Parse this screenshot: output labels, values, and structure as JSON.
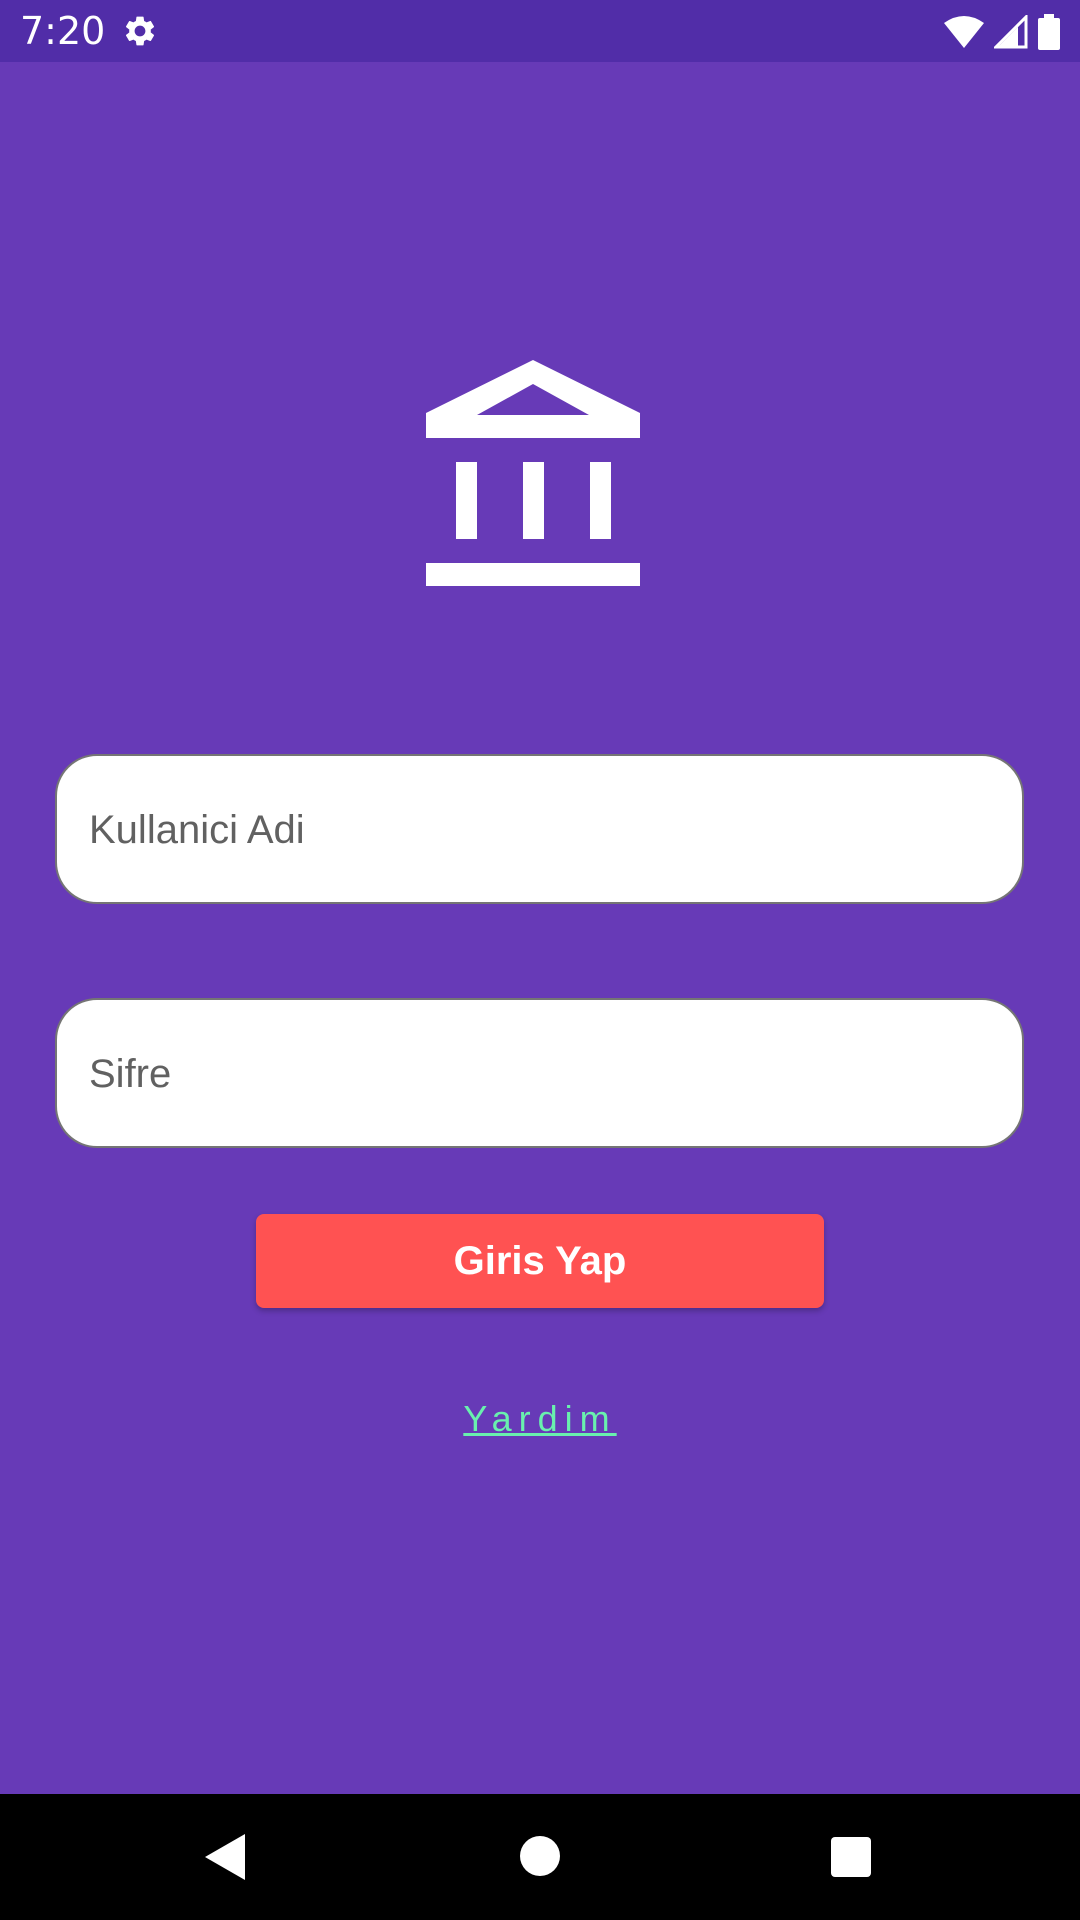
{
  "status_bar": {
    "time": "7:20",
    "icons": [
      "gear-icon",
      "wifi-icon",
      "cell-signal-icon",
      "battery-icon"
    ]
  },
  "logo": {
    "icon": "bank-icon"
  },
  "form": {
    "username_placeholder": "Kullanici Adi",
    "username_value": "",
    "password_placeholder": "Sifre",
    "password_value": "",
    "login_label": "Giris Yap",
    "help_label": "Yardim"
  },
  "nav_bar": {
    "icons": [
      "back-icon",
      "home-icon",
      "recents-icon"
    ]
  },
  "colors": {
    "background": "#673AB7",
    "status_bar": "#512DA8",
    "button": "#FF5252",
    "link": "#69F0AE",
    "field": "#FFFFFF"
  }
}
